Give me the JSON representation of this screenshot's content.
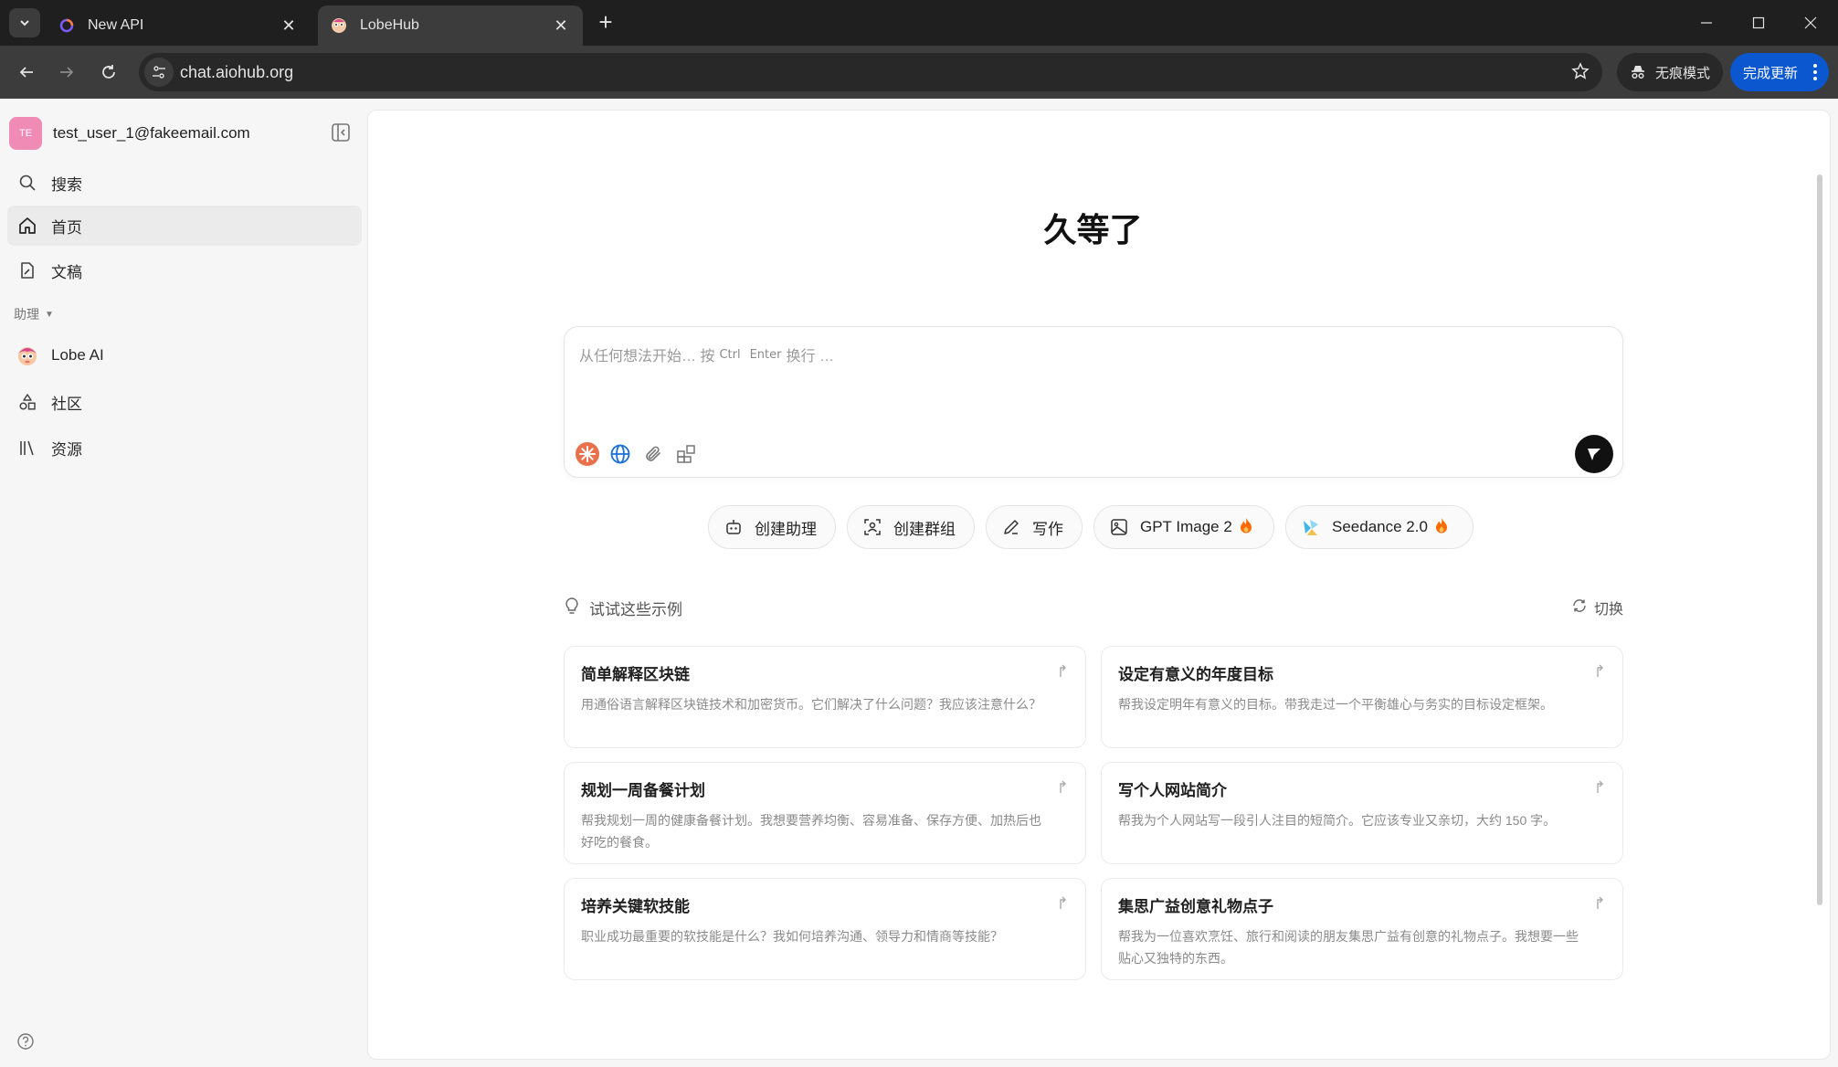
{
  "browser": {
    "tabs": [
      {
        "title": "New API",
        "active": false
      },
      {
        "title": "LobeHub",
        "active": true
      }
    ],
    "url": "chat.aiohub.org",
    "incognito_label": "无痕模式",
    "update_label": "完成更新"
  },
  "sidebar": {
    "user_initials": "TE",
    "user_email": "test_user_1@fakeemail.com",
    "items": [
      {
        "label": "搜索",
        "icon": "search-icon"
      },
      {
        "label": "首页",
        "icon": "home-icon"
      },
      {
        "label": "文稿",
        "icon": "document-icon"
      }
    ],
    "section_label": "助理",
    "assistants": [
      {
        "label": "Lobe AI",
        "icon": "lobe-ai-avatar"
      }
    ],
    "bottom_items": [
      {
        "label": "社区",
        "icon": "community-icon"
      },
      {
        "label": "资源",
        "icon": "library-icon"
      }
    ]
  },
  "main": {
    "welcome": "久等了",
    "composer": {
      "placeholder_prefix": "从任何想法开始… 按",
      "key1": "Ctrl",
      "key2": "Enter",
      "placeholder_suffix": "换行 …"
    },
    "chips": [
      {
        "label": "创建助理",
        "icon": "robot-icon"
      },
      {
        "label": "创建群组",
        "icon": "group-icon"
      },
      {
        "label": "写作",
        "icon": "pen-icon"
      },
      {
        "label": "GPT Image 2",
        "icon": "image-icon",
        "hot": true
      },
      {
        "label": "Seedance 2.0",
        "icon": "seedance-icon",
        "hot": true
      }
    ],
    "examples_label": "试试这些示例",
    "switch_label": "切换",
    "examples": [
      {
        "title": "简单解释区块链",
        "desc": "用通俗语言解释区块链技术和加密货币。它们解决了什么问题？我应该注意什么？"
      },
      {
        "title": "设定有意义的年度目标",
        "desc": "帮我设定明年有意义的目标。带我走过一个平衡雄心与务实的目标设定框架。"
      },
      {
        "title": "规划一周备餐计划",
        "desc": "帮我规划一周的健康备餐计划。我想要营养均衡、容易准备、保存方便、加热后也好吃的餐食。"
      },
      {
        "title": "写个人网站简介",
        "desc": "帮我为个人网站写一段引人注目的短简介。它应该专业又亲切，大约 150 字。"
      },
      {
        "title": "培养关键软技能",
        "desc": "职业成功最重要的软技能是什么？我如何培养沟通、领导力和情商等技能？"
      },
      {
        "title": "集思广益创意礼物点子",
        "desc": "帮我为一位喜欢烹饪、旅行和阅读的朋友集思广益有创意的礼物点子。我想要一些贴心又独特的东西。"
      }
    ]
  },
  "colors": {
    "accent": "#0b57d0",
    "avatar": "#f08bb5",
    "fire": "#ff6a00"
  }
}
